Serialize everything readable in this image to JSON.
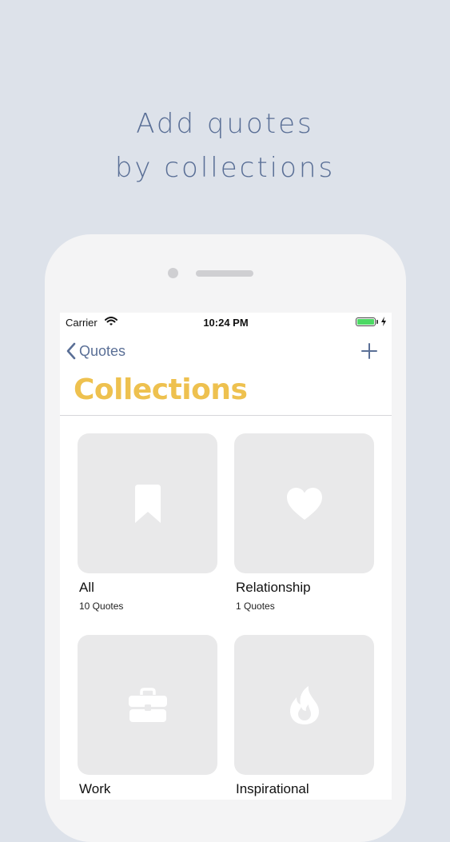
{
  "promo": {
    "line1": "Add quotes",
    "line2": "by collections"
  },
  "status_bar": {
    "carrier": "Carrier",
    "time": "10:24 PM",
    "battery_level": 1.0
  },
  "nav": {
    "back_label": "Quotes",
    "add_icon": "plus-icon"
  },
  "page": {
    "title": "Collections"
  },
  "collections": [
    {
      "name": "All",
      "count": "10 Quotes",
      "icon": "bookmark-icon"
    },
    {
      "name": "Relationship",
      "count": "1 Quotes",
      "icon": "heart-icon"
    },
    {
      "name": "Work",
      "count": "",
      "icon": "briefcase-icon"
    },
    {
      "name": "Inspirational",
      "count": "",
      "icon": "flame-icon"
    }
  ],
  "colors": {
    "accent": "#5a6f96",
    "title": "#eec14f",
    "background": "#dde2ea",
    "tile": "#e9e9ea"
  }
}
